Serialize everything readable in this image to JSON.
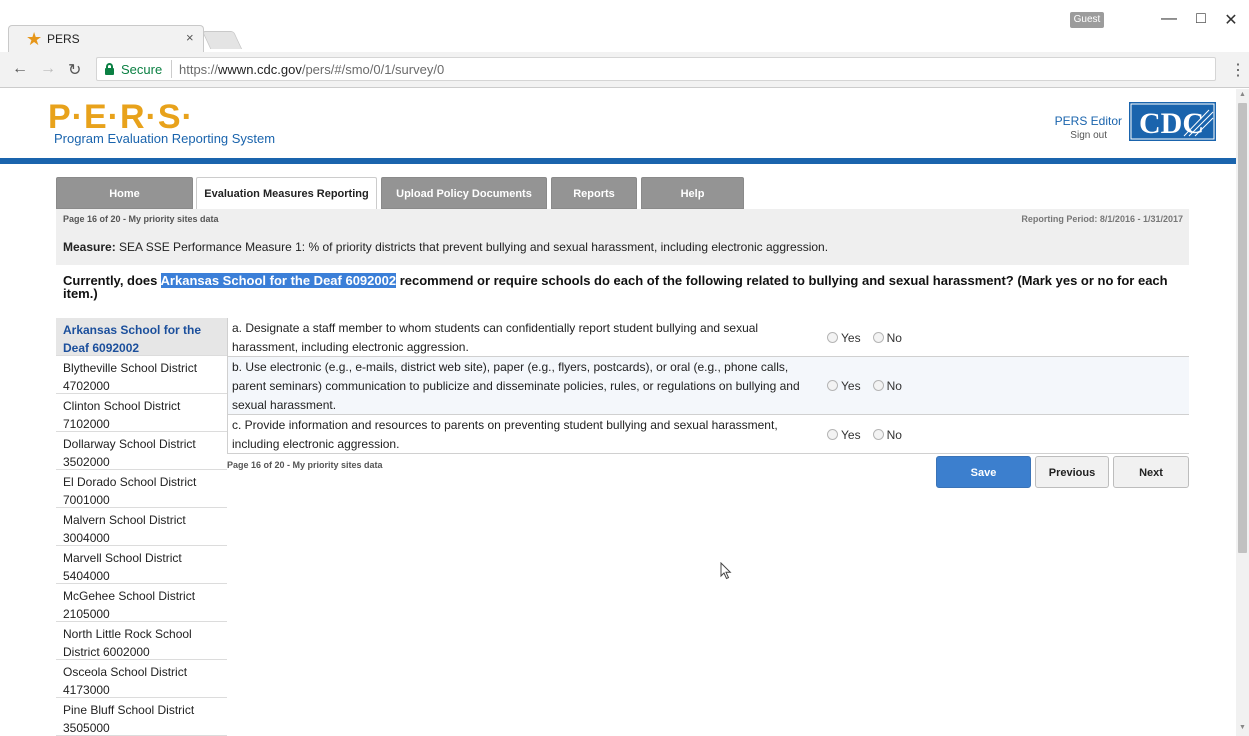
{
  "browser": {
    "tab_title": "PERS",
    "tab_close": "×",
    "guest_label": "Guest",
    "secure_label": "Secure",
    "url_scheme": "https://",
    "url_host": "wwwn.cdc.gov",
    "url_path": "/pers/#/smo/0/1/survey/0"
  },
  "header": {
    "logo_text": "P·E·R·S·",
    "logo_subtitle": "Program Evaluation Reporting System",
    "editor_label": "PERS Editor",
    "signout_label": "Sign out",
    "cdc_logo_text": "CDC"
  },
  "nav": {
    "tabs": [
      {
        "label": "Home"
      },
      {
        "label": "Evaluation Measures Reporting"
      },
      {
        "label": "Upload Policy Documents"
      },
      {
        "label": "Reports"
      },
      {
        "label": "Help"
      }
    ],
    "active_index": 1
  },
  "page_info": {
    "page_label": "Page 16 of 20 - My priority sites data",
    "reporting_period": "Reporting Period: 8/1/2016 - 1/31/2017"
  },
  "measure": {
    "label": "Measure:",
    "text": "SEA SSE Performance Measure 1: % of priority districts that prevent bullying and sexual harassment, including electronic aggression."
  },
  "question": {
    "prefix": "Currently, does ",
    "highlight": "Arkansas School for the Deaf 6092002",
    "suffix": " recommend or require schools do each of the following related to bullying and sexual harassment? (Mark yes or no for each item.)"
  },
  "sites": [
    {
      "line1": "Arkansas School for the",
      "line2": "Deaf 6092002",
      "active": true
    },
    {
      "line1": "Blytheville School District",
      "line2": "4702000"
    },
    {
      "line1": "Clinton School District",
      "line2": "7102000"
    },
    {
      "line1": "Dollarway School District",
      "line2": "3502000"
    },
    {
      "line1": "El Dorado School District",
      "line2": "7001000"
    },
    {
      "line1": "Malvern School District",
      "line2": "3004000"
    },
    {
      "line1": "Marvell School District",
      "line2": "5404000"
    },
    {
      "line1": "McGehee School District",
      "line2": "2105000"
    },
    {
      "line1": "North Little Rock School",
      "line2": "District 6002000"
    },
    {
      "line1": "Osceola School District",
      "line2": "4173000"
    },
    {
      "line1": "Pine Bluff School District",
      "line2": "3505000"
    }
  ],
  "items": [
    {
      "text": "a. Designate a staff member to whom students can confidentially report student bullying and sexual harassment, including electronic aggression.",
      "yes": "Yes",
      "no": "No"
    },
    {
      "text": "b. Use electronic (e.g., e-mails, district web site), paper (e.g., flyers, postcards), or oral (e.g., phone calls, parent seminars) communication to publicize and disseminate policies, rules, or regulations on bullying and sexual harassment.",
      "yes": "Yes",
      "no": "No"
    },
    {
      "text": "c. Provide information and resources to parents on preventing student bullying and sexual harassment, including electronic aggression.",
      "yes": "Yes",
      "no": "No"
    }
  ],
  "footer": {
    "page_label": "Page 16 of 20 - My priority sites data",
    "save_label": "Save",
    "previous_label": "Previous",
    "next_label": "Next"
  },
  "colors": {
    "brand_blue": "#1a64ad",
    "logo_orange": "#e8a21b",
    "save_blue": "#3c7fce",
    "highlight_blue": "#3b7fd8"
  }
}
